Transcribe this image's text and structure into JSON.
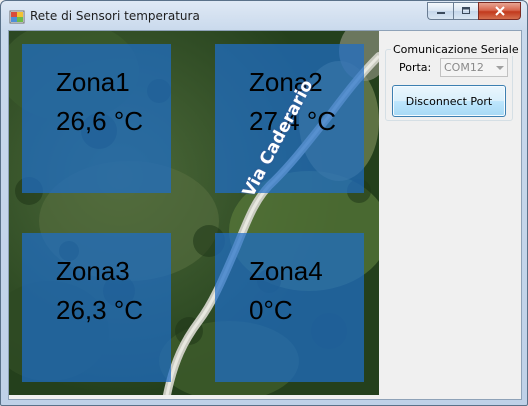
{
  "window": {
    "title": "Rete di Sensori temperatura"
  },
  "map": {
    "street_label": "Via Caderario",
    "zones": [
      {
        "name": "Zona1",
        "temperature": "26,6 °C"
      },
      {
        "name": "Zona2",
        "temperature": "27,4 °C"
      },
      {
        "name": "Zona3",
        "temperature": "26,3 °C"
      },
      {
        "name": "Zona4",
        "temperature": "0°C"
      }
    ]
  },
  "serial": {
    "group_title": "Comunicazione Seriale",
    "port_label": "Porta:",
    "port_value": "COM12",
    "disconnect_label": "Disconnect Port"
  },
  "colors": {
    "zone_fill": "#1e6ec8",
    "close_button": "#c2391d"
  }
}
